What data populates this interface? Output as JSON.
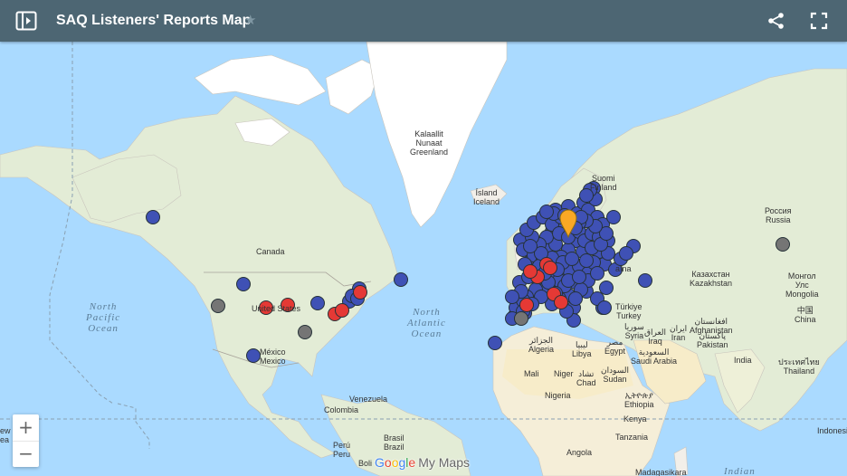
{
  "header": {
    "title": "SAQ Listeners' Reports Map",
    "star_icon": "star-icon",
    "share_icon": "share-icon",
    "fullscreen_icon": "fullscreen-icon",
    "sidebar_icon": "sidebar-toggle-icon"
  },
  "colors": {
    "header_bg": "#4d6673",
    "water": "#aadaff",
    "land": "#f2efe9",
    "marker_blue": "#3f51b5",
    "marker_red": "#e53935",
    "marker_gray": "#757575",
    "marker_selected": "#f9a825"
  },
  "map": {
    "countries": [
      {
        "id": "greenland",
        "text": "Kalaallit\nNunaat\nGreenland"
      },
      {
        "id": "iceland",
        "text": "Ísland\nIceland"
      },
      {
        "id": "canada",
        "text": "Canada"
      },
      {
        "id": "usa",
        "text": "United States"
      },
      {
        "id": "mexico",
        "text": "México\nMexico"
      },
      {
        "id": "suomi",
        "text": "Suomi\nFinland"
      },
      {
        "id": "russia",
        "text": "Россия\nRussia"
      },
      {
        "id": "kazakhstan",
        "text": "Казахстан\nKazakhstan"
      },
      {
        "id": "mongolia",
        "text": "Монгол\nУлс\nMongolia"
      },
      {
        "id": "china",
        "text": "中国\nChina"
      },
      {
        "id": "turkey",
        "text": "Türkiye\nTurkey"
      },
      {
        "id": "syria",
        "text": "سوريا\nSyria"
      },
      {
        "id": "iraq",
        "text": "العراق\nIraq"
      },
      {
        "id": "iran",
        "text": "ایران\nIran"
      },
      {
        "id": "afghanistan",
        "text": "افغانستان\nAfghanistan"
      },
      {
        "id": "pakistan",
        "text": "پاکستان\nPakistan"
      },
      {
        "id": "india",
        "text": "India"
      },
      {
        "id": "thailand",
        "text": "ประเทศไทย\nThailand"
      },
      {
        "id": "algeria",
        "text": "الجزائر\nAlgeria"
      },
      {
        "id": "libya",
        "text": "ليبيا\nLibya"
      },
      {
        "id": "egypt",
        "text": "مصر\nEgypt"
      },
      {
        "id": "saudi",
        "text": "السعودية\nSaudi Arabia"
      },
      {
        "id": "mali",
        "text": "Mali"
      },
      {
        "id": "niger",
        "text": "Niger"
      },
      {
        "id": "chad",
        "text": "تشاد\nChad"
      },
      {
        "id": "sudan",
        "text": "السودان\nSudan"
      },
      {
        "id": "nigeria",
        "text": "Nigeria"
      },
      {
        "id": "ethiopia",
        "text": "ኢትዮጵያ\nEthiopia"
      },
      {
        "id": "kenya",
        "text": "Kenya"
      },
      {
        "id": "tanzania",
        "text": "Tanzania"
      },
      {
        "id": "angola",
        "text": "Angola"
      },
      {
        "id": "madagascar",
        "text": "Madagasikara"
      },
      {
        "id": "venezuela",
        "text": "Venezuela"
      },
      {
        "id": "colombia",
        "text": "Colombia"
      },
      {
        "id": "peru",
        "text": "Perú\nPeru"
      },
      {
        "id": "brasil",
        "text": "Brasil\nBrazil"
      },
      {
        "id": "bolivia",
        "text": "Boli"
      },
      {
        "id": "indonesia",
        "text": "Indonesi"
      },
      {
        "id": "newzealand",
        "text": "ew\nea"
      },
      {
        "id": "ukraine",
        "text": "aïna"
      }
    ],
    "oceans": [
      {
        "id": "north-pacific",
        "text": "North\nPacific\nOcean"
      },
      {
        "id": "north-atlantic",
        "text": "North\nAtlantic\nOcean"
      },
      {
        "id": "indian",
        "text": "Indian"
      }
    ],
    "zoom_in": "+",
    "zoom_out": "−"
  },
  "markers": {
    "blue_count": 130,
    "red_count": 12,
    "gray_count": 4,
    "selected_count": 1
  },
  "attribution": {
    "google": "Google",
    "my_maps": "My Maps"
  }
}
